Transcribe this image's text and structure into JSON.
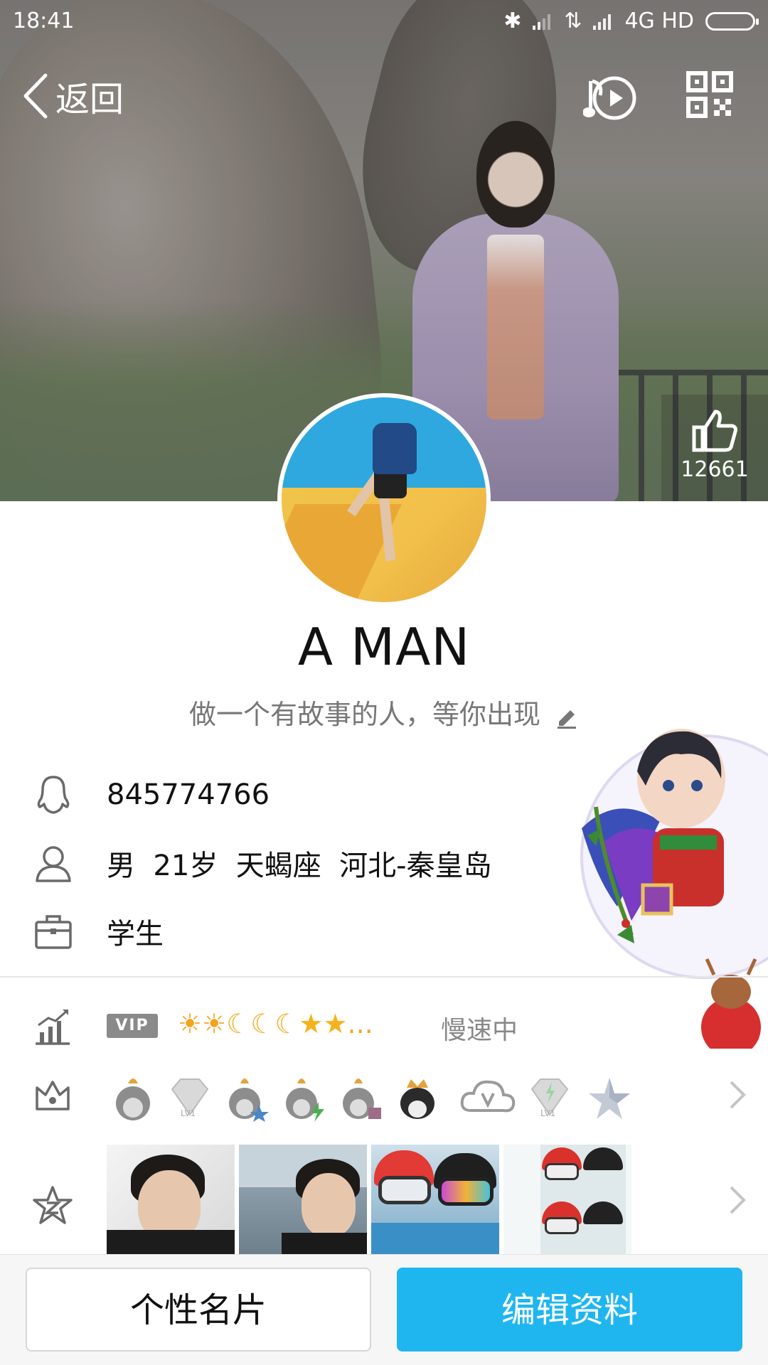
{
  "status_bar": {
    "time": "18:41",
    "network": "4G HD"
  },
  "nav": {
    "back_label": "返回",
    "music_icon": "music-play-icon",
    "qr_icon": "qr-code-icon"
  },
  "like": {
    "count": "12661",
    "icon": "thumbs-up-icon"
  },
  "profile": {
    "nickname": "A MAN",
    "signature": "做一个有故事的人，等你出现",
    "qq_number": "845774766",
    "basic_info": "男  21岁  天蝎座  河北-秦皇岛",
    "occupation": "学生"
  },
  "level": {
    "vip_label": "VIP",
    "icons": [
      "sun",
      "sun",
      "moon",
      "moon",
      "moon",
      "star",
      "star"
    ],
    "more": "...",
    "status": "慢速中"
  },
  "badges": [
    "penguin-badge",
    "diamond-lv1-badge",
    "penguin-star-badge",
    "penguin-lightning-badge",
    "penguin-gift-badge",
    "penguin-crown-badge",
    "cloud-v-badge",
    "diamond-lv1-badge",
    "star-badge"
  ],
  "buttons": {
    "card_label": "个性名片",
    "edit_label": "编辑资料"
  },
  "colors": {
    "accent": "#1fb6f0",
    "level_gold": "#f5a623",
    "muted_text": "#888888"
  }
}
